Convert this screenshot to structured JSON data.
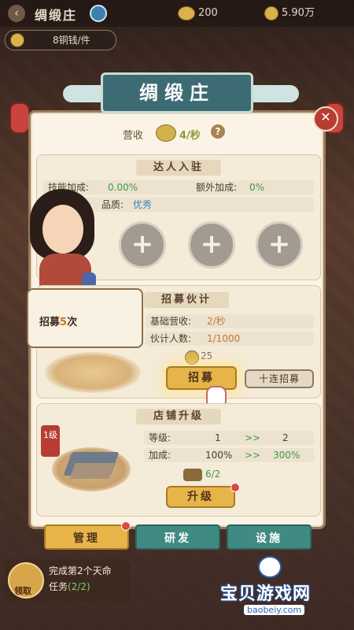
{
  "topbar": {
    "title": "绸缎庄",
    "resource1": "200",
    "resource2": "5.90万"
  },
  "price_label": "8铜钱/件",
  "panel": {
    "title": "绸缎庄",
    "income_label": "营收",
    "income_value": "4/秒"
  },
  "talent": {
    "title": "达人入驻",
    "skill_bonus_label": "技能加成:",
    "skill_bonus_value": "0.00%",
    "extra_bonus_label": "额外加成:",
    "extra_bonus_value": "0%",
    "quality_label": "品质:",
    "quality_value": "优秀"
  },
  "recruit": {
    "title": "招募伙计",
    "tooltip_prefix": "招募",
    "tooltip_count": "5",
    "tooltip_suffix": "次",
    "base_income_label": "基础营收:",
    "base_income_value": "2/秒",
    "staff_count_label": "伙计人数:",
    "staff_count_value": "1/1000",
    "cost": "25",
    "recruit_button": "招募",
    "ten_recruit_button": "十连招募"
  },
  "shop_upgrade": {
    "title": "店铺升级",
    "badge": "1级",
    "level_label": "等级:",
    "level_from": "1",
    "level_to": "2",
    "arrow": ">>",
    "bonus_label": "加成:",
    "bonus_from": "100%",
    "bonus_to": "300%",
    "material": "6/2",
    "upgrade_button": "升级"
  },
  "tabs": [
    "管理",
    "研发",
    "设施"
  ],
  "quest": {
    "claim_label": "领取",
    "line1": "完成第2个天命",
    "line2_prefix": "任务",
    "progress": "(2/2)"
  },
  "watermark": {
    "text": "宝贝游戏网",
    "url": "baobeiy.com"
  },
  "colors": {
    "panel_bg": "#fbf4e6",
    "banner": "#3d6b74",
    "gold_button": "#e6b449",
    "green_value": "#3e9a4a",
    "tab_manage": "#e6b449",
    "tab_research": "#3f8a82",
    "tab_facility": "#3f8a82"
  }
}
